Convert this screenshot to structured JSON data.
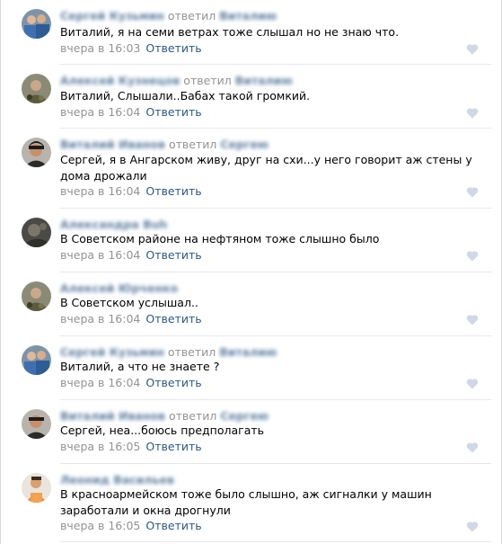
{
  "comments": [
    {
      "author": "Сергей Кузьмин",
      "replied": "ответил",
      "target": "Виталию",
      "text": "Виталий, я на семи ветрах тоже слышал но не знаю что.",
      "time": "вчера в 16:03",
      "reply": "Ответить",
      "avatar": "avatar-group-blue"
    },
    {
      "author": "Алексей Кузнецов",
      "replied": "ответил",
      "target": "Виталию",
      "text": "Виталий, Слышали..Бабах такой громкий.",
      "time": "вчера в 16:04",
      "reply": "Ответить",
      "avatar": "avatar-camo"
    },
    {
      "author": "Виталий Иванов",
      "replied": "ответил",
      "target": "Сергею",
      "text": "Сергей, я в Ангарском живу, друг на схи...у него говорит аж стены у дома дрожали",
      "time": "вчера в 16:04",
      "reply": "Ответить",
      "avatar": "avatar-man-dark"
    },
    {
      "author": "Александра Buh",
      "replied": "",
      "target": "",
      "text": "В Советском районе на нефтяном тоже слышно было",
      "time": "вчера в 16:04",
      "reply": "Ответить",
      "avatar": "avatar-dark-blur"
    },
    {
      "author": "Алексей Юрченко",
      "replied": "",
      "target": "",
      "text": "В Советском услышал..",
      "time": "вчера в 16:04",
      "reply": "Ответить",
      "avatar": "avatar-camo"
    },
    {
      "author": "Сергей Кузьмин",
      "replied": "ответил",
      "target": "Виталию",
      "text": "Виталий, а что не знаете ?",
      "time": "вчера в 16:04",
      "reply": "Ответить",
      "avatar": "avatar-group-blue"
    },
    {
      "author": "Виталий Иванов",
      "replied": "ответил",
      "target": "Сергею",
      "text": "Сергей, неа...боюсь предполагать",
      "time": "вчера в 16:05",
      "reply": "Ответить",
      "avatar": "avatar-man-dark"
    },
    {
      "author": "Леонид Васильев",
      "replied": "",
      "target": "",
      "text": "В красноармейском тоже было слышно, аж сигналки у машин заработали и окна дрогнули",
      "time": "вчера в 16:05",
      "reply": "Ответить",
      "avatar": "avatar-man-orange"
    }
  ],
  "icons": {
    "like": "heart-icon"
  },
  "colors": {
    "link": "#2a5885",
    "meta": "#939393",
    "divider": "#e7e8ec",
    "like": "#cfd8e3"
  }
}
